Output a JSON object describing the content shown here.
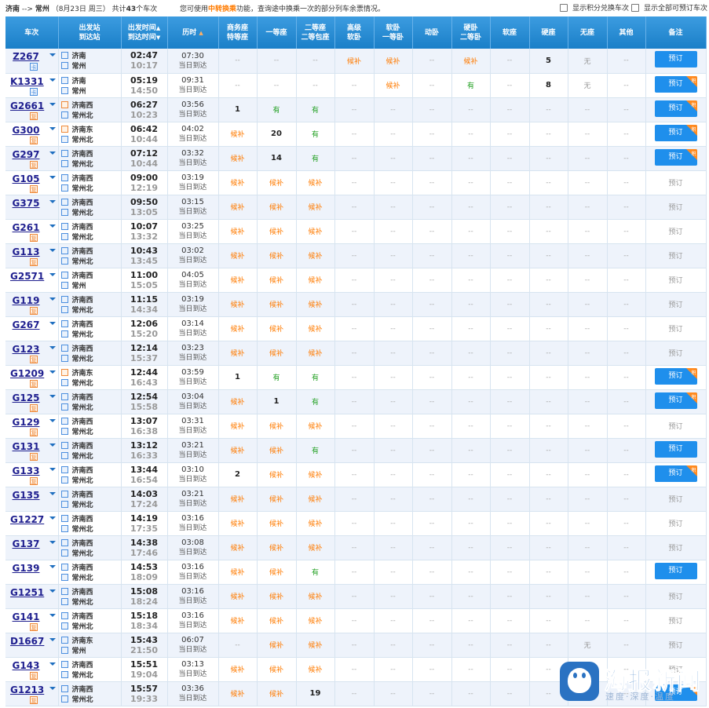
{
  "header": {
    "route_from": "济南",
    "route_arrow": "-->",
    "route_to": "常州",
    "date_label": "（8月23日 周三）",
    "count_prefix": "共计",
    "count": "43",
    "count_suffix": "个车次",
    "hint_prefix": "您可使用",
    "hint_highlight": "中转换乘",
    "hint_suffix": "功能，查询途中换乘一次的部分列车余票情况。",
    "option_partial": "显示积分兑换车次",
    "option_all": "显示全部可预订车次"
  },
  "columns": {
    "train": "车次",
    "station": [
      "出发站",
      "到达站"
    ],
    "time": [
      "出发时间",
      "到达时间"
    ],
    "duration": "历时",
    "business": [
      "商务座",
      "特等座"
    ],
    "first": "一等座",
    "second": [
      "二等座",
      "二等包座"
    ],
    "hsoft": [
      "高级",
      "软卧"
    ],
    "soft": [
      "软卧",
      "一等卧"
    ],
    "moving": "动卧",
    "hard_sleeper": [
      "硬卧",
      "二等卧"
    ],
    "soft_seat": "软座",
    "hard_seat": "硬座",
    "no_seat": "无座",
    "other": "其他",
    "remark": "备注"
  },
  "labels": {
    "dash": "--",
    "same_day": "当日到达",
    "book": "预订",
    "badge_fu": "复",
    "badge_ka": "卡",
    "corner": "积"
  },
  "trains": [
    {
      "no": "Z267",
      "badge": "ka",
      "from": "济南",
      "to": "常州",
      "from_type": "pass",
      "to_type": "end",
      "dep": "02:47",
      "arr": "10:17",
      "dur": "07:30",
      "seats": [
        "--",
        "--",
        "--",
        "候补",
        "候补",
        "--",
        "候补",
        "--",
        "5",
        "无",
        "--"
      ],
      "book": "on",
      "corner": false
    },
    {
      "no": "K1331",
      "badge": "ka",
      "from": "济南",
      "to": "常州",
      "from_type": "pass",
      "to_type": "end",
      "dep": "05:19",
      "arr": "14:50",
      "dur": "09:31",
      "seats": [
        "--",
        "--",
        "--",
        "--",
        "候补",
        "--",
        "有",
        "--",
        "8",
        "无",
        "--"
      ],
      "book": "on",
      "corner": true
    },
    {
      "no": "G2661",
      "badge": "fu",
      "from": "济南西",
      "to": "常州北",
      "from_type": "start",
      "to_type": "end",
      "dep": "06:27",
      "arr": "10:23",
      "dur": "03:56",
      "seats": [
        "1",
        "有",
        "有",
        "--",
        "--",
        "--",
        "--",
        "--",
        "--",
        "--",
        "--"
      ],
      "book": "on",
      "corner": true
    },
    {
      "no": "G300",
      "badge": "fu",
      "from": "济南东",
      "to": "常州北",
      "from_type": "start",
      "to_type": "end",
      "dep": "06:42",
      "arr": "10:44",
      "dur": "04:02",
      "seats": [
        "候补",
        "20",
        "有",
        "--",
        "--",
        "--",
        "--",
        "--",
        "--",
        "--",
        "--"
      ],
      "book": "on",
      "corner": true
    },
    {
      "no": "G297",
      "badge": "fu",
      "from": "济南西",
      "to": "常州北",
      "from_type": "pass",
      "to_type": "end",
      "dep": "07:12",
      "arr": "10:44",
      "dur": "03:32",
      "seats": [
        "候补",
        "14",
        "有",
        "--",
        "--",
        "--",
        "--",
        "--",
        "--",
        "--",
        "--"
      ],
      "book": "on",
      "corner": true
    },
    {
      "no": "G105",
      "badge": "fu",
      "from": "济南西",
      "to": "常州北",
      "from_type": "pass",
      "to_type": "end",
      "dep": "09:00",
      "arr": "12:19",
      "dur": "03:19",
      "seats": [
        "候补",
        "候补",
        "候补",
        "--",
        "--",
        "--",
        "--",
        "--",
        "--",
        "--",
        "--"
      ],
      "book": "off",
      "corner": false
    },
    {
      "no": "G375",
      "badge": "",
      "from": "济南西",
      "to": "常州北",
      "from_type": "pass",
      "to_type": "end",
      "dep": "09:50",
      "arr": "13:05",
      "dur": "03:15",
      "seats": [
        "候补",
        "候补",
        "候补",
        "--",
        "--",
        "--",
        "--",
        "--",
        "--",
        "--",
        "--"
      ],
      "book": "off",
      "corner": false
    },
    {
      "no": "G261",
      "badge": "fu",
      "from": "济南西",
      "to": "常州北",
      "from_type": "pass",
      "to_type": "end",
      "dep": "10:07",
      "arr": "13:32",
      "dur": "03:25",
      "seats": [
        "候补",
        "候补",
        "候补",
        "--",
        "--",
        "--",
        "--",
        "--",
        "--",
        "--",
        "--"
      ],
      "book": "off",
      "corner": false
    },
    {
      "no": "G113",
      "badge": "fu",
      "from": "济南西",
      "to": "常州北",
      "from_type": "pass",
      "to_type": "end",
      "dep": "10:43",
      "arr": "13:45",
      "dur": "03:02",
      "seats": [
        "候补",
        "候补",
        "候补",
        "--",
        "--",
        "--",
        "--",
        "--",
        "--",
        "--",
        "--"
      ],
      "book": "off",
      "corner": false
    },
    {
      "no": "G2571",
      "badge": "",
      "from": "济南西",
      "to": "常州",
      "from_type": "pass",
      "to_type": "end",
      "dep": "11:00",
      "arr": "15:05",
      "dur": "04:05",
      "seats": [
        "候补",
        "候补",
        "候补",
        "--",
        "--",
        "--",
        "--",
        "--",
        "--",
        "--",
        "--"
      ],
      "book": "off",
      "corner": false
    },
    {
      "no": "G119",
      "badge": "fu",
      "from": "济南西",
      "to": "常州北",
      "from_type": "pass",
      "to_type": "end",
      "dep": "11:15",
      "arr": "14:34",
      "dur": "03:19",
      "seats": [
        "候补",
        "候补",
        "候补",
        "--",
        "--",
        "--",
        "--",
        "--",
        "--",
        "--",
        "--"
      ],
      "book": "off",
      "corner": false
    },
    {
      "no": "G267",
      "badge": "",
      "from": "济南西",
      "to": "常州北",
      "from_type": "pass",
      "to_type": "end",
      "dep": "12:06",
      "arr": "15:20",
      "dur": "03:14",
      "seats": [
        "候补",
        "候补",
        "候补",
        "--",
        "--",
        "--",
        "--",
        "--",
        "--",
        "--",
        "--"
      ],
      "book": "off",
      "corner": false
    },
    {
      "no": "G123",
      "badge": "fu",
      "from": "济南西",
      "to": "常州北",
      "from_type": "pass",
      "to_type": "end",
      "dep": "12:14",
      "arr": "15:37",
      "dur": "03:23",
      "seats": [
        "候补",
        "候补",
        "候补",
        "--",
        "--",
        "--",
        "--",
        "--",
        "--",
        "--",
        "--"
      ],
      "book": "off",
      "corner": false
    },
    {
      "no": "G1209",
      "badge": "fu",
      "from": "济南东",
      "to": "常州北",
      "from_type": "start",
      "to_type": "end",
      "dep": "12:44",
      "arr": "16:43",
      "dur": "03:59",
      "seats": [
        "1",
        "有",
        "有",
        "--",
        "--",
        "--",
        "--",
        "--",
        "--",
        "--",
        "--"
      ],
      "book": "on",
      "corner": true
    },
    {
      "no": "G125",
      "badge": "fu",
      "from": "济南西",
      "to": "常州北",
      "from_type": "pass",
      "to_type": "end",
      "dep": "12:54",
      "arr": "15:58",
      "dur": "03:04",
      "seats": [
        "候补",
        "1",
        "有",
        "--",
        "--",
        "--",
        "--",
        "--",
        "--",
        "--",
        "--"
      ],
      "book": "on",
      "corner": true
    },
    {
      "no": "G129",
      "badge": "fu",
      "from": "济南西",
      "to": "常州北",
      "from_type": "pass",
      "to_type": "end",
      "dep": "13:07",
      "arr": "16:38",
      "dur": "03:31",
      "seats": [
        "候补",
        "候补",
        "候补",
        "--",
        "--",
        "--",
        "--",
        "--",
        "--",
        "--",
        "--"
      ],
      "book": "off",
      "corner": false
    },
    {
      "no": "G131",
      "badge": "fu",
      "from": "济南西",
      "to": "常州北",
      "from_type": "pass",
      "to_type": "end",
      "dep": "13:12",
      "arr": "16:33",
      "dur": "03:21",
      "seats": [
        "候补",
        "候补",
        "有",
        "--",
        "--",
        "--",
        "--",
        "--",
        "--",
        "--",
        "--"
      ],
      "book": "on",
      "corner": false
    },
    {
      "no": "G133",
      "badge": "fu",
      "from": "济南西",
      "to": "常州北",
      "from_type": "pass",
      "to_type": "end",
      "dep": "13:44",
      "arr": "16:54",
      "dur": "03:10",
      "seats": [
        "2",
        "候补",
        "候补",
        "--",
        "--",
        "--",
        "--",
        "--",
        "--",
        "--",
        "--"
      ],
      "book": "on",
      "corner": true
    },
    {
      "no": "G135",
      "badge": "",
      "from": "济南西",
      "to": "常州北",
      "from_type": "pass",
      "to_type": "end",
      "dep": "14:03",
      "arr": "17:24",
      "dur": "03:21",
      "seats": [
        "候补",
        "候补",
        "候补",
        "--",
        "--",
        "--",
        "--",
        "--",
        "--",
        "--",
        "--"
      ],
      "book": "off",
      "corner": false
    },
    {
      "no": "G1227",
      "badge": "",
      "from": "济南西",
      "to": "常州北",
      "from_type": "pass",
      "to_type": "end",
      "dep": "14:19",
      "arr": "17:35",
      "dur": "03:16",
      "seats": [
        "候补",
        "候补",
        "候补",
        "--",
        "--",
        "--",
        "--",
        "--",
        "--",
        "--",
        "--"
      ],
      "book": "off",
      "corner": false
    },
    {
      "no": "G137",
      "badge": "",
      "from": "济南西",
      "to": "常州北",
      "from_type": "pass",
      "to_type": "end",
      "dep": "14:38",
      "arr": "17:46",
      "dur": "03:08",
      "seats": [
        "候补",
        "候补",
        "候补",
        "--",
        "--",
        "--",
        "--",
        "--",
        "--",
        "--",
        "--"
      ],
      "book": "off",
      "corner": false
    },
    {
      "no": "G139",
      "badge": "",
      "from": "济南西",
      "to": "常州北",
      "from_type": "pass",
      "to_type": "end",
      "dep": "14:53",
      "arr": "18:09",
      "dur": "03:16",
      "seats": [
        "候补",
        "候补",
        "有",
        "--",
        "--",
        "--",
        "--",
        "--",
        "--",
        "--",
        "--"
      ],
      "book": "on",
      "corner": false
    },
    {
      "no": "G1251",
      "badge": "",
      "from": "济南西",
      "to": "常州北",
      "from_type": "pass",
      "to_type": "end",
      "dep": "15:08",
      "arr": "18:24",
      "dur": "03:16",
      "seats": [
        "候补",
        "候补",
        "候补",
        "--",
        "--",
        "--",
        "--",
        "--",
        "--",
        "--",
        "--"
      ],
      "book": "off",
      "corner": false
    },
    {
      "no": "G141",
      "badge": "fu",
      "from": "济南西",
      "to": "常州北",
      "from_type": "pass",
      "to_type": "end",
      "dep": "15:18",
      "arr": "18:34",
      "dur": "03:16",
      "seats": [
        "候补",
        "候补",
        "候补",
        "--",
        "--",
        "--",
        "--",
        "--",
        "--",
        "--",
        "--"
      ],
      "book": "off",
      "corner": false
    },
    {
      "no": "D1667",
      "badge": "",
      "from": "济南东",
      "to": "常州",
      "from_type": "pass",
      "to_type": "end",
      "dep": "15:43",
      "arr": "21:50",
      "dur": "06:07",
      "seats": [
        "--",
        "候补",
        "候补",
        "--",
        "--",
        "--",
        "--",
        "--",
        "--",
        "无",
        "--"
      ],
      "book": "off",
      "corner": false
    },
    {
      "no": "G143",
      "badge": "fu",
      "from": "济南西",
      "to": "常州北",
      "from_type": "pass",
      "to_type": "end",
      "dep": "15:51",
      "arr": "19:04",
      "dur": "03:13",
      "seats": [
        "候补",
        "候补",
        "候补",
        "--",
        "--",
        "--",
        "--",
        "--",
        "--",
        "--",
        "--"
      ],
      "book": "off",
      "corner": false
    },
    {
      "no": "G1213",
      "badge": "fu",
      "from": "济南西",
      "to": "常州北",
      "from_type": "pass",
      "to_type": "end",
      "dep": "15:57",
      "arr": "19:33",
      "dur": "03:36",
      "seats": [
        "候补",
        "候补",
        "19",
        "--",
        "--",
        "--",
        "--",
        "--",
        "--",
        "--",
        "--"
      ],
      "book": "on",
      "corner": true
    }
  ],
  "watermark": {
    "brand": "海报新闻",
    "slogan": "速度·深度·温度"
  }
}
